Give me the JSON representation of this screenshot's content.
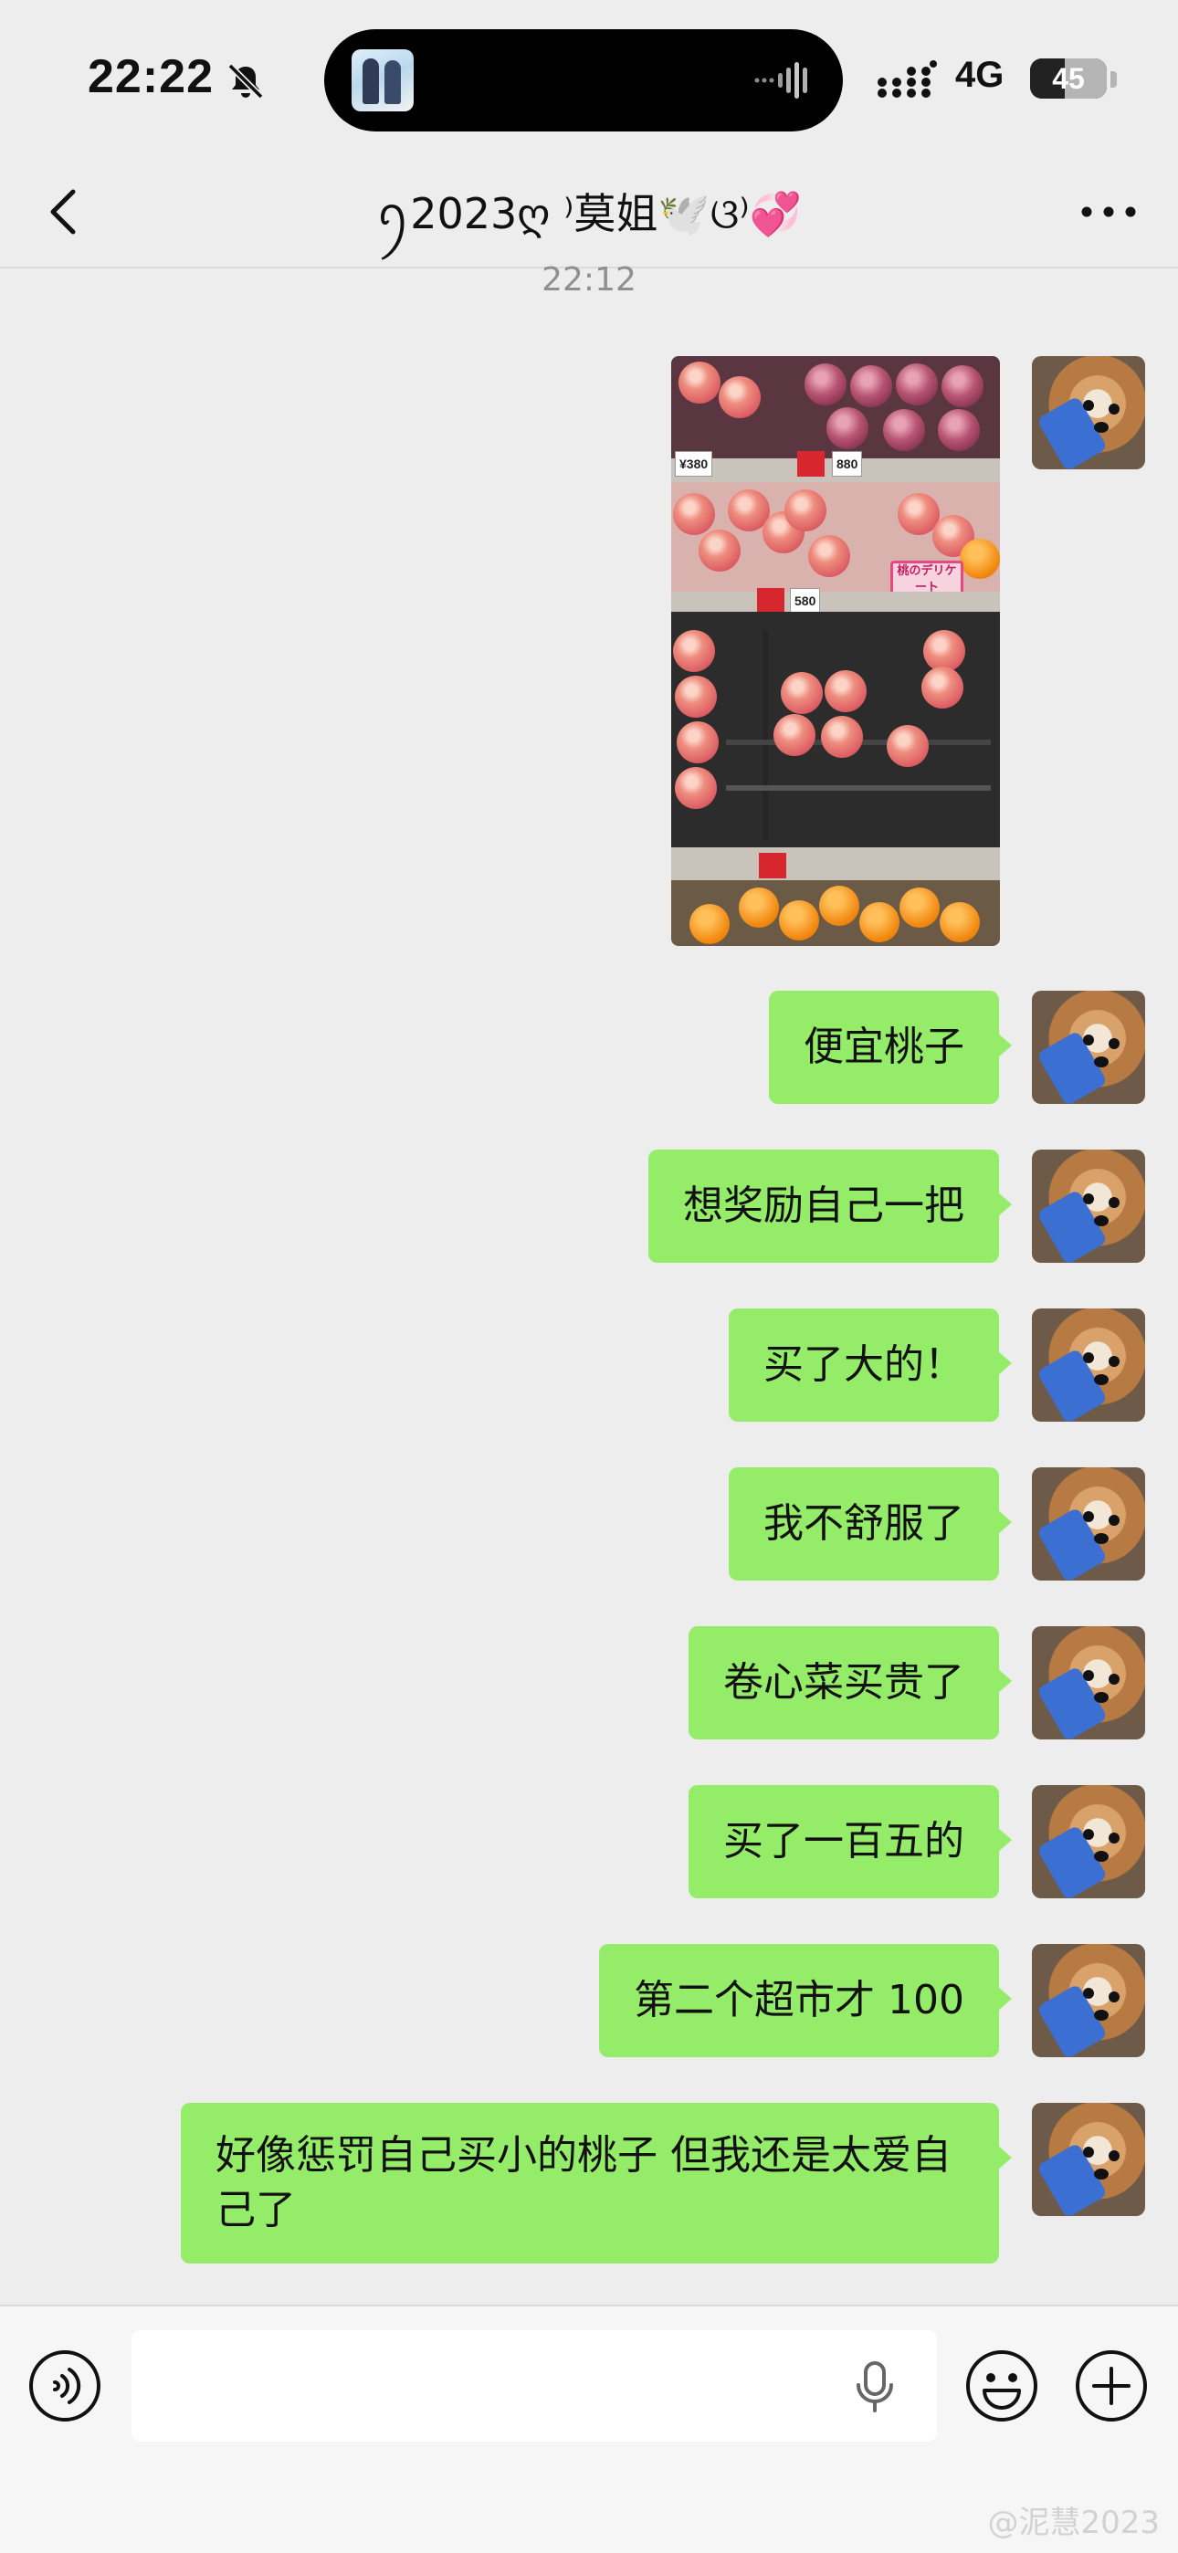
{
  "status_bar": {
    "time": "22:22",
    "network": "4G",
    "battery": "45",
    "battery_level_percent": 45,
    "icons": [
      "bell-slash-icon",
      "signal-icon",
      "battery-icon"
    ]
  },
  "header": {
    "title": "ꪆ2023ღ ⁾莫姐🕊️ଓ⁾💞",
    "icons": [
      "chevron-left-icon",
      "more-icon"
    ]
  },
  "chat": {
    "timestamp": "22:12",
    "photo": {
      "price_tags": [
        "¥380",
        "880",
        "580"
      ],
      "sign_text": "桃のデリケート"
    },
    "messages": [
      "便宜桃子",
      "想奖励自己一把",
      "买了大的！",
      "我不舒服了",
      "卷心菜买贵了",
      "买了一百五的",
      "第二个超市才 100",
      "好像惩罚自己买小的桃子 但我还是太爱自己了"
    ]
  },
  "input_bar": {
    "placeholder": "",
    "icons": [
      "voice-icon",
      "microphone-icon",
      "emoji-icon",
      "plus-icon"
    ]
  },
  "watermark": "@泥慧2023",
  "colors": {
    "background": "#ededed",
    "bubble": "#95ec69",
    "input_bar": "#f6f6f6"
  }
}
